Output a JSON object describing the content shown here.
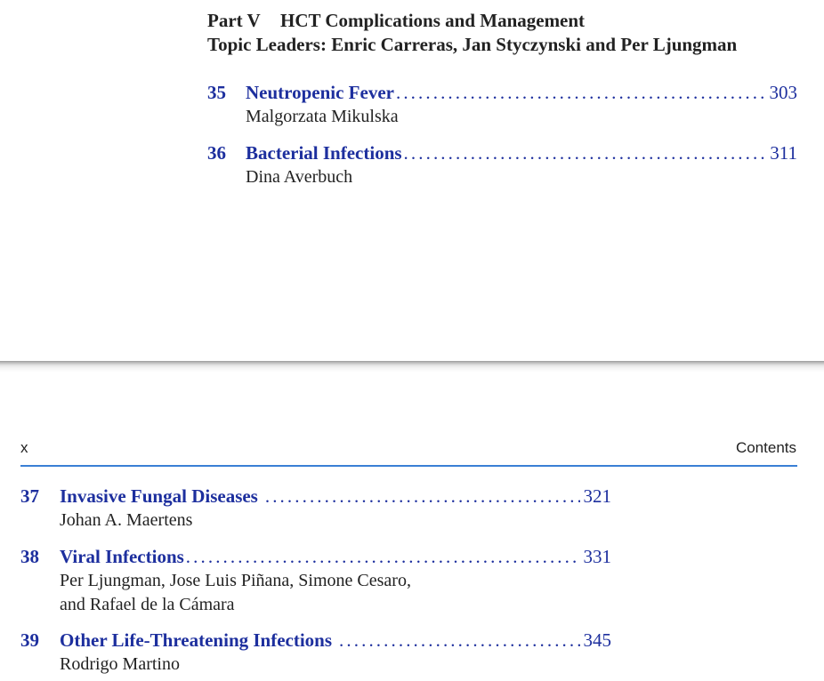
{
  "top_page": {
    "part_label": "Part V",
    "part_title": "HCT Complications and Management",
    "topic_leaders": "Topic Leaders: Enric Carreras, Jan Styczynski and Per Ljungman",
    "entries": [
      {
        "number": "35",
        "title": "Neutropenic Fever",
        "page": "303",
        "authors": [
          "Malgorzata Mikulska"
        ]
      },
      {
        "number": "36",
        "title": "Bacterial Infections",
        "page": "311",
        "authors": [
          "Dina Averbuch"
        ]
      }
    ]
  },
  "bottom_page": {
    "running_head_left": "x",
    "running_head_right": "Contents",
    "entries": [
      {
        "number": "37",
        "title": "Invasive Fungal Diseases",
        "page": "321",
        "authors": [
          "Johan A. Maertens"
        ]
      },
      {
        "number": "38",
        "title": "Viral Infections",
        "page": "331",
        "authors": [
          "Per Ljungman, Jose Luis Piñana, Simone Cesaro,",
          "and Rafael de la Cámara"
        ]
      },
      {
        "number": "39",
        "title": "Other Life-Threatening Infections",
        "page": "345",
        "authors": [
          "Rodrigo Martino"
        ]
      }
    ]
  },
  "colors": {
    "link_blue": "#1d2f9e",
    "rule_blue": "#3a7fd5",
    "text": "#222222"
  }
}
